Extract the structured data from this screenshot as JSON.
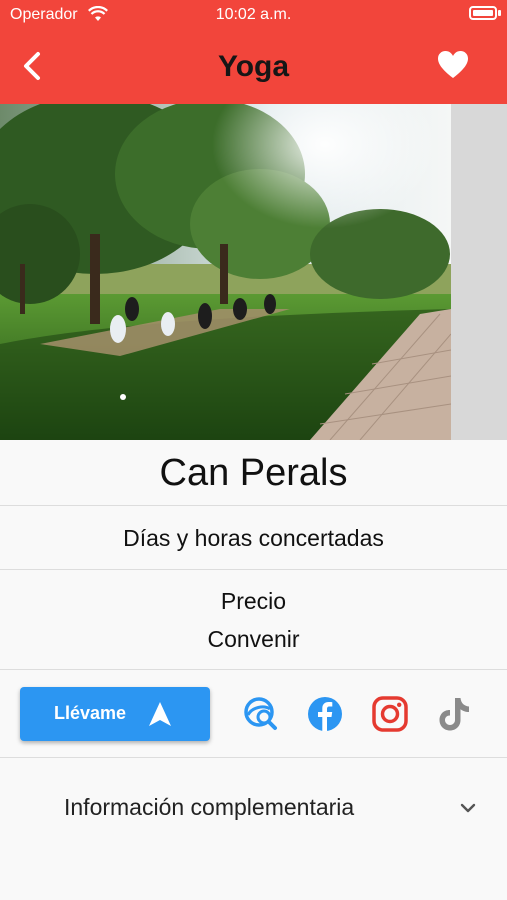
{
  "status_bar": {
    "carrier": "Operador",
    "time": "10:02 a.m."
  },
  "header": {
    "title": "Yoga",
    "background_color": "#f2453b"
  },
  "place": {
    "name": "Can Perals",
    "schedule": "Días y horas concertadas",
    "price_label": "Precio",
    "price_value": "Convenir"
  },
  "actions": {
    "directions_label": "Llévame",
    "accent_color": "#2c96f2",
    "social_icons": [
      "web-search-icon",
      "facebook-icon",
      "instagram-icon",
      "tiktok-icon"
    ]
  },
  "more_info": {
    "label": "Información complementaria"
  },
  "gallery": {
    "current_page": 1
  }
}
